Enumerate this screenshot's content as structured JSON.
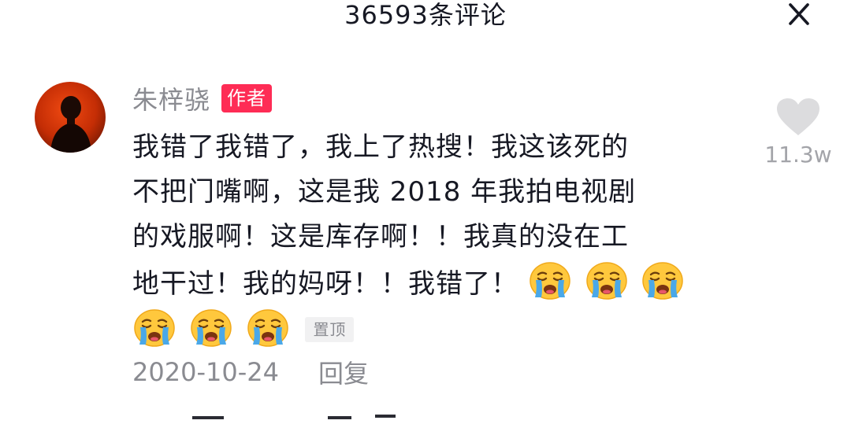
{
  "header": {
    "title": "36593条评论"
  },
  "comment": {
    "author": "朱梓骁",
    "author_badge": "作者",
    "text_lines": [
      "我错了我错了，我上了热搜！我这该死的",
      "不把门嘴啊，这是我 2018 年我拍电视剧",
      "的戏服啊！这是库存啊！！我真的没在工",
      "地干过！我的妈呀！！我错了！"
    ],
    "emoji": "crying-face",
    "emoji_count": 6,
    "pinned_label": "置顶",
    "date": "2020-10-24",
    "reply_label": "回复",
    "like_count": "11.3w"
  },
  "colors": {
    "badge": "#fe2c55",
    "text": "#161823",
    "muted": "#8a8b91",
    "like_icon": "#dcdcde",
    "emoji_face": "#ffc83d",
    "emoji_tears": "#4aa8e8"
  }
}
